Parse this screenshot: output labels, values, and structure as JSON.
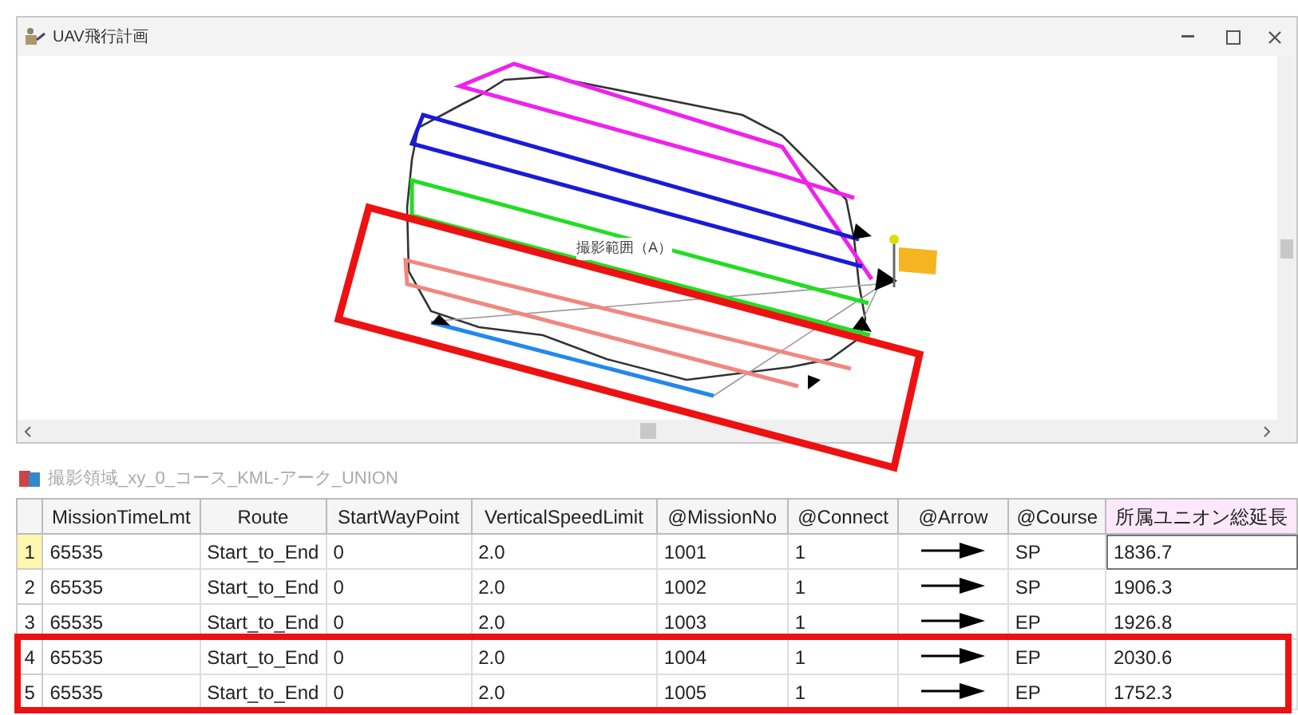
{
  "window": {
    "title": "UAV飛行計画"
  },
  "map": {
    "area_label": "撮影範囲（A）"
  },
  "table": {
    "caption": "撮影領域_xy_0_コース_KML-アーク_UNION",
    "columns": [
      {
        "label": "MissionTimeLmt",
        "highlighted": false
      },
      {
        "label": "Route",
        "highlighted": false
      },
      {
        "label": "StartWayPoint",
        "highlighted": false
      },
      {
        "label": "VerticalSpeedLimit",
        "highlighted": false
      },
      {
        "label": "@MissionNo",
        "highlighted": false
      },
      {
        "label": "@Connect",
        "highlighted": false
      },
      {
        "label": "@Arrow",
        "highlighted": false
      },
      {
        "label": "@Course",
        "highlighted": false
      },
      {
        "label": "所属ユニオン総延長",
        "highlighted": true
      }
    ],
    "rows": [
      {
        "number": "1",
        "selected": true,
        "marked": false,
        "cells": [
          "65535",
          "Start_to_End",
          "0",
          "2.0",
          "1001",
          "1",
          null,
          "SP",
          "1836.7"
        ]
      },
      {
        "number": "2",
        "selected": false,
        "marked": false,
        "cells": [
          "65535",
          "Start_to_End",
          "0",
          "2.0",
          "1002",
          "1",
          null,
          "SP",
          "1906.3"
        ]
      },
      {
        "number": "3",
        "selected": false,
        "marked": false,
        "cells": [
          "65535",
          "Start_to_End",
          "0",
          "2.0",
          "1003",
          "1",
          null,
          "EP",
          "1926.8"
        ]
      },
      {
        "number": "4",
        "selected": false,
        "marked": true,
        "cells": [
          "65535",
          "Start_to_End",
          "0",
          "2.0",
          "1004",
          "1",
          null,
          "EP",
          "2030.6"
        ]
      },
      {
        "number": "5",
        "selected": false,
        "marked": true,
        "cells": [
          "65535",
          "Start_to_End",
          "0",
          "2.0",
          "1005",
          "1",
          null,
          "EP",
          "1752.3"
        ]
      }
    ]
  }
}
